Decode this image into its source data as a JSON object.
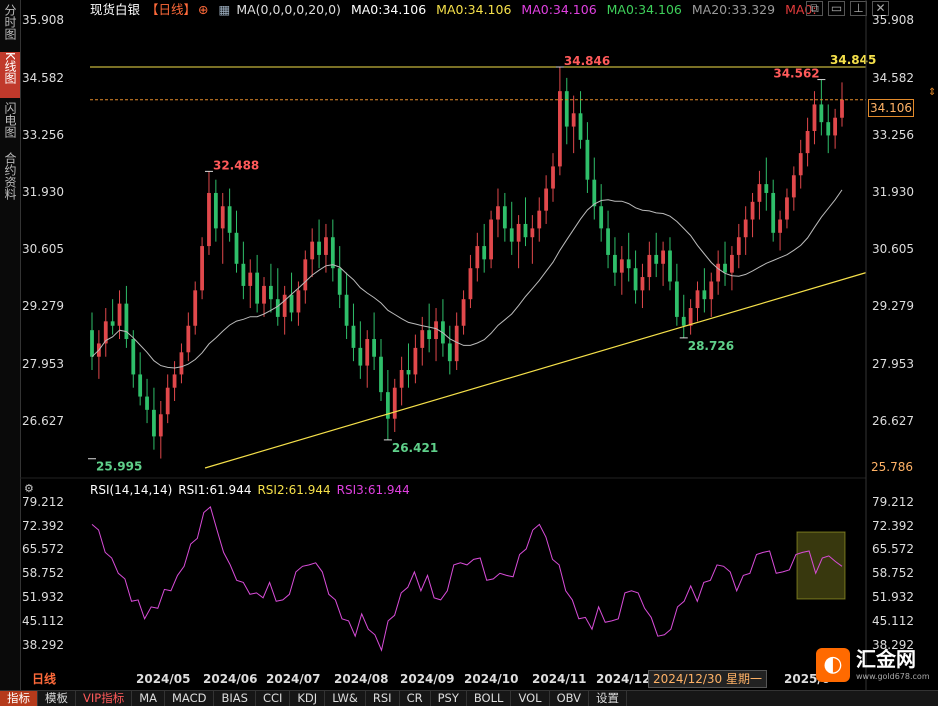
{
  "header": {
    "instrument": "现货白银",
    "period": "【日线】",
    "ma_group": "MA(0,0,0,0,20,0)",
    "ma_items": [
      {
        "label": "MA0:34.106",
        "color": "#ffffff"
      },
      {
        "label": "MA0:34.106",
        "color": "#f5e04a"
      },
      {
        "label": "MA0:34.106",
        "color": "#e040e0"
      },
      {
        "label": "MA0:34.106",
        "color": "#3ecf5a"
      },
      {
        "label": "MA20:33.329",
        "color": "#9a9a9a"
      },
      {
        "label": "MA0:",
        "color": "#e23b3b"
      }
    ]
  },
  "side_tabs": [
    {
      "label": "分时图",
      "active": false
    },
    {
      "label": "K线图",
      "active": true
    },
    {
      "label": "闪电图",
      "active": false
    },
    {
      "label": "合约资料",
      "active": false
    }
  ],
  "top_icons": [
    "layers-icon",
    "window-icon",
    "pin-icon",
    "close-icon"
  ],
  "price_axis": {
    "ticks": [
      "35.908",
      "34.582",
      "33.256",
      "31.930",
      "30.605",
      "29.279",
      "27.953",
      "26.627"
    ],
    "tick_values": [
      35.908,
      34.582,
      33.256,
      31.93,
      30.605,
      29.279,
      27.953,
      26.627
    ],
    "current_price": "34.106",
    "low_label": "25.786"
  },
  "rsi": {
    "legend": "RSI(14,14,14)",
    "rsi1": "RSI1:61.944",
    "rsi2": "RSI2:61.944",
    "rsi3": "RSI3:61.944",
    "ticks": [
      "79.212",
      "72.392",
      "65.572",
      "58.752",
      "51.932",
      "45.112",
      "38.292"
    ],
    "tick_values": [
      79.212,
      72.392,
      65.572,
      58.752,
      51.932,
      45.112,
      38.292
    ]
  },
  "date_axis": {
    "labels": [
      "2024/05",
      "2024/06",
      "2024/07",
      "2024/08",
      "2024/09",
      "2024/10",
      "2024/11",
      "2024/12",
      "2025/0"
    ],
    "cursor_date": "2024/12/30 星期一"
  },
  "bottom_toolbar": {
    "period_label": "日线",
    "items": [
      "指标",
      "模板",
      "VIP指标",
      "MA",
      "MACD",
      "BIAS",
      "CCI",
      "KDJ",
      "LW&",
      "RSI",
      "CR",
      "PSY",
      "BOLL",
      "VOL",
      "OBV",
      "设置"
    ]
  },
  "annotations": [
    {
      "text": "32.488",
      "color": "#ff5a5a"
    },
    {
      "text": "25.995",
      "color": "#5fd08a"
    },
    {
      "text": "26.421",
      "color": "#5fd08a"
    },
    {
      "text": "34.846",
      "color": "#ff5a5a"
    },
    {
      "text": "28.726",
      "color": "#5fd08a"
    },
    {
      "text": "34.562",
      "color": "#ff5a5a"
    },
    {
      "text": "34.845",
      "color": "#f5e04a"
    }
  ],
  "logo": {
    "name": "汇金网",
    "url": "www.gold678.com"
  },
  "chart_data": {
    "type": "candlestick",
    "title": "现货白银 日线",
    "ylim": [
      25.786,
      35.908
    ],
    "ma20_last": 33.329,
    "close_last": 34.106,
    "key_points": [
      {
        "label": "32.488",
        "value": 32.488,
        "kind": "high",
        "date": "2024/05"
      },
      {
        "label": "25.995",
        "value": 25.995,
        "kind": "low",
        "date": "2024/04"
      },
      {
        "label": "26.421",
        "value": 26.421,
        "kind": "low",
        "date": "2024/08"
      },
      {
        "label": "34.846",
        "value": 34.846,
        "kind": "high",
        "date": "2024/10"
      },
      {
        "label": "28.726",
        "value": 28.726,
        "kind": "low",
        "date": "2024/12"
      },
      {
        "label": "34.562",
        "value": 34.562,
        "kind": "high",
        "date": "2025/0"
      }
    ],
    "horizontal_lines": [
      {
        "value": 34.845,
        "style": "solid",
        "color": "#f5e04a"
      },
      {
        "value": 34.106,
        "style": "dashed",
        "color": "#e38a2a"
      }
    ],
    "trendline": {
      "from_value": 25.786,
      "to_value": 30.2,
      "color": "#f5e04a"
    },
    "candles": [
      {
        "o": 28.9,
        "h": 29.3,
        "l": 28.0,
        "c": 28.3
      },
      {
        "o": 28.3,
        "h": 28.9,
        "l": 27.8,
        "c": 28.6
      },
      {
        "o": 28.6,
        "h": 29.4,
        "l": 28.3,
        "c": 29.1
      },
      {
        "o": 29.1,
        "h": 29.6,
        "l": 28.8,
        "c": 29.0
      },
      {
        "o": 29.0,
        "h": 29.8,
        "l": 28.7,
        "c": 29.5
      },
      {
        "o": 29.5,
        "h": 29.9,
        "l": 28.5,
        "c": 28.7
      },
      {
        "o": 28.7,
        "h": 28.9,
        "l": 27.6,
        "c": 27.9
      },
      {
        "o": 27.9,
        "h": 28.4,
        "l": 27.2,
        "c": 27.4
      },
      {
        "o": 27.4,
        "h": 27.8,
        "l": 26.8,
        "c": 27.1
      },
      {
        "o": 27.1,
        "h": 27.6,
        "l": 26.2,
        "c": 26.5
      },
      {
        "o": 26.5,
        "h": 27.3,
        "l": 26.0,
        "c": 27.0
      },
      {
        "o": 27.0,
        "h": 27.9,
        "l": 26.8,
        "c": 27.6
      },
      {
        "o": 27.6,
        "h": 28.2,
        "l": 27.3,
        "c": 27.9
      },
      {
        "o": 27.9,
        "h": 28.6,
        "l": 27.7,
        "c": 28.4
      },
      {
        "o": 28.4,
        "h": 29.3,
        "l": 28.2,
        "c": 29.0
      },
      {
        "o": 29.0,
        "h": 30.0,
        "l": 28.8,
        "c": 29.8
      },
      {
        "o": 29.8,
        "h": 31.0,
        "l": 29.6,
        "c": 30.8
      },
      {
        "o": 30.8,
        "h": 32.488,
        "l": 30.6,
        "c": 32.0
      },
      {
        "o": 32.0,
        "h": 32.3,
        "l": 30.9,
        "c": 31.2
      },
      {
        "o": 31.2,
        "h": 32.0,
        "l": 30.4,
        "c": 31.7
      },
      {
        "o": 31.7,
        "h": 32.1,
        "l": 30.9,
        "c": 31.1
      },
      {
        "o": 31.1,
        "h": 31.6,
        "l": 30.2,
        "c": 30.4
      },
      {
        "o": 30.4,
        "h": 30.9,
        "l": 29.6,
        "c": 29.9
      },
      {
        "o": 29.9,
        "h": 30.5,
        "l": 29.4,
        "c": 30.2
      },
      {
        "o": 30.2,
        "h": 30.6,
        "l": 29.3,
        "c": 29.5
      },
      {
        "o": 29.5,
        "h": 30.1,
        "l": 29.2,
        "c": 29.9
      },
      {
        "o": 29.9,
        "h": 30.4,
        "l": 29.3,
        "c": 29.6
      },
      {
        "o": 29.6,
        "h": 30.3,
        "l": 29.0,
        "c": 29.2
      },
      {
        "o": 29.2,
        "h": 29.9,
        "l": 28.8,
        "c": 29.7
      },
      {
        "o": 29.7,
        "h": 30.2,
        "l": 29.1,
        "c": 29.3
      },
      {
        "o": 29.3,
        "h": 30.0,
        "l": 29.0,
        "c": 29.8
      },
      {
        "o": 29.8,
        "h": 30.7,
        "l": 29.5,
        "c": 30.5
      },
      {
        "o": 30.5,
        "h": 31.2,
        "l": 30.1,
        "c": 30.9
      },
      {
        "o": 30.9,
        "h": 31.4,
        "l": 30.3,
        "c": 30.6
      },
      {
        "o": 30.6,
        "h": 31.3,
        "l": 30.2,
        "c": 31.0
      },
      {
        "o": 31.0,
        "h": 31.4,
        "l": 30.0,
        "c": 30.3
      },
      {
        "o": 30.3,
        "h": 30.8,
        "l": 29.4,
        "c": 29.7
      },
      {
        "o": 29.7,
        "h": 30.2,
        "l": 28.7,
        "c": 29.0
      },
      {
        "o": 29.0,
        "h": 29.5,
        "l": 28.2,
        "c": 28.5
      },
      {
        "o": 28.5,
        "h": 29.1,
        "l": 27.8,
        "c": 28.1
      },
      {
        "o": 28.1,
        "h": 28.9,
        "l": 27.6,
        "c": 28.7
      },
      {
        "o": 28.7,
        "h": 29.3,
        "l": 28.0,
        "c": 28.3
      },
      {
        "o": 28.3,
        "h": 28.7,
        "l": 27.3,
        "c": 27.5
      },
      {
        "o": 27.5,
        "h": 28.0,
        "l": 26.421,
        "c": 26.9
      },
      {
        "o": 26.9,
        "h": 27.8,
        "l": 26.6,
        "c": 27.6
      },
      {
        "o": 27.6,
        "h": 28.3,
        "l": 27.2,
        "c": 28.0
      },
      {
        "o": 28.0,
        "h": 28.6,
        "l": 27.6,
        "c": 27.9
      },
      {
        "o": 27.9,
        "h": 28.8,
        "l": 27.7,
        "c": 28.5
      },
      {
        "o": 28.5,
        "h": 29.2,
        "l": 28.1,
        "c": 28.9
      },
      {
        "o": 28.9,
        "h": 29.5,
        "l": 28.4,
        "c": 28.7
      },
      {
        "o": 28.7,
        "h": 29.4,
        "l": 28.2,
        "c": 29.1
      },
      {
        "o": 29.1,
        "h": 29.6,
        "l": 28.3,
        "c": 28.6
      },
      {
        "o": 28.6,
        "h": 29.0,
        "l": 27.9,
        "c": 28.2
      },
      {
        "o": 28.2,
        "h": 29.3,
        "l": 28.0,
        "c": 29.0
      },
      {
        "o": 29.0,
        "h": 29.8,
        "l": 28.8,
        "c": 29.6
      },
      {
        "o": 29.6,
        "h": 30.6,
        "l": 29.4,
        "c": 30.3
      },
      {
        "o": 30.3,
        "h": 31.1,
        "l": 30.0,
        "c": 30.8
      },
      {
        "o": 30.8,
        "h": 31.3,
        "l": 30.2,
        "c": 30.5
      },
      {
        "o": 30.5,
        "h": 31.6,
        "l": 30.3,
        "c": 31.4
      },
      {
        "o": 31.4,
        "h": 32.1,
        "l": 31.0,
        "c": 31.7
      },
      {
        "o": 31.7,
        "h": 32.0,
        "l": 30.9,
        "c": 31.2
      },
      {
        "o": 31.2,
        "h": 31.8,
        "l": 30.6,
        "c": 30.9
      },
      {
        "o": 30.9,
        "h": 31.5,
        "l": 30.3,
        "c": 31.3
      },
      {
        "o": 31.3,
        "h": 31.9,
        "l": 30.8,
        "c": 31.0
      },
      {
        "o": 31.0,
        "h": 31.5,
        "l": 30.4,
        "c": 31.2
      },
      {
        "o": 31.2,
        "h": 31.9,
        "l": 30.9,
        "c": 31.6
      },
      {
        "o": 31.6,
        "h": 32.4,
        "l": 31.3,
        "c": 32.1
      },
      {
        "o": 32.1,
        "h": 32.9,
        "l": 31.8,
        "c": 32.6
      },
      {
        "o": 32.6,
        "h": 34.846,
        "l": 32.4,
        "c": 34.3
      },
      {
        "o": 34.3,
        "h": 34.6,
        "l": 33.1,
        "c": 33.5
      },
      {
        "o": 33.5,
        "h": 34.2,
        "l": 32.9,
        "c": 33.8
      },
      {
        "o": 33.8,
        "h": 34.3,
        "l": 33.0,
        "c": 33.2
      },
      {
        "o": 33.2,
        "h": 33.6,
        "l": 32.0,
        "c": 32.3
      },
      {
        "o": 32.3,
        "h": 32.8,
        "l": 31.4,
        "c": 31.7
      },
      {
        "o": 31.7,
        "h": 32.2,
        "l": 30.9,
        "c": 31.2
      },
      {
        "o": 31.2,
        "h": 31.6,
        "l": 30.3,
        "c": 30.6
      },
      {
        "o": 30.6,
        "h": 31.0,
        "l": 29.9,
        "c": 30.2
      },
      {
        "o": 30.2,
        "h": 30.8,
        "l": 29.7,
        "c": 30.5
      },
      {
        "o": 30.5,
        "h": 31.1,
        "l": 30.0,
        "c": 30.3
      },
      {
        "o": 30.3,
        "h": 30.7,
        "l": 29.5,
        "c": 29.8
      },
      {
        "o": 29.8,
        "h": 30.4,
        "l": 29.4,
        "c": 30.1
      },
      {
        "o": 30.1,
        "h": 30.9,
        "l": 29.8,
        "c": 30.6
      },
      {
        "o": 30.6,
        "h": 31.1,
        "l": 30.1,
        "c": 30.4
      },
      {
        "o": 30.4,
        "h": 30.9,
        "l": 29.9,
        "c": 30.7
      },
      {
        "o": 30.7,
        "h": 31.0,
        "l": 29.8,
        "c": 30.0
      },
      {
        "o": 30.0,
        "h": 30.4,
        "l": 29.0,
        "c": 29.2
      },
      {
        "o": 29.2,
        "h": 29.7,
        "l": 28.726,
        "c": 29.0
      },
      {
        "o": 29.0,
        "h": 29.6,
        "l": 28.8,
        "c": 29.4
      },
      {
        "o": 29.4,
        "h": 30.0,
        "l": 29.1,
        "c": 29.8
      },
      {
        "o": 29.8,
        "h": 30.3,
        "l": 29.3,
        "c": 29.6
      },
      {
        "o": 29.6,
        "h": 30.2,
        "l": 29.2,
        "c": 30.0
      },
      {
        "o": 30.0,
        "h": 30.7,
        "l": 29.7,
        "c": 30.4
      },
      {
        "o": 30.4,
        "h": 30.9,
        "l": 29.9,
        "c": 30.2
      },
      {
        "o": 30.2,
        "h": 30.8,
        "l": 29.8,
        "c": 30.6
      },
      {
        "o": 30.6,
        "h": 31.3,
        "l": 30.3,
        "c": 31.0
      },
      {
        "o": 31.0,
        "h": 31.7,
        "l": 30.6,
        "c": 31.4
      },
      {
        "o": 31.4,
        "h": 32.0,
        "l": 31.0,
        "c": 31.8
      },
      {
        "o": 31.8,
        "h": 32.5,
        "l": 31.4,
        "c": 32.2
      },
      {
        "o": 32.2,
        "h": 32.8,
        "l": 31.6,
        "c": 32.0
      },
      {
        "o": 32.0,
        "h": 32.3,
        "l": 30.9,
        "c": 31.1
      },
      {
        "o": 31.1,
        "h": 31.6,
        "l": 30.7,
        "c": 31.4
      },
      {
        "o": 31.4,
        "h": 32.1,
        "l": 31.2,
        "c": 31.9
      },
      {
        "o": 31.9,
        "h": 32.6,
        "l": 31.6,
        "c": 32.4
      },
      {
        "o": 32.4,
        "h": 33.2,
        "l": 32.1,
        "c": 32.9
      },
      {
        "o": 32.9,
        "h": 33.7,
        "l": 32.6,
        "c": 33.4
      },
      {
        "o": 33.4,
        "h": 34.3,
        "l": 33.1,
        "c": 34.0
      },
      {
        "o": 34.0,
        "h": 34.562,
        "l": 33.3,
        "c": 33.6
      },
      {
        "o": 33.6,
        "h": 34.0,
        "l": 32.9,
        "c": 33.3
      },
      {
        "o": 33.3,
        "h": 33.9,
        "l": 33.0,
        "c": 33.7
      },
      {
        "o": 33.7,
        "h": 34.5,
        "l": 33.5,
        "c": 34.106
      }
    ],
    "rsi_series": [
      74,
      70,
      66,
      62,
      60,
      56,
      52,
      50,
      47,
      48,
      50,
      53,
      55,
      57,
      62,
      66,
      70,
      75,
      79,
      70,
      66,
      60,
      58,
      55,
      54,
      52,
      53,
      55,
      52,
      50,
      54,
      58,
      62,
      60,
      63,
      58,
      54,
      50,
      47,
      44,
      42,
      46,
      44,
      40,
      38,
      44,
      48,
      52,
      56,
      58,
      55,
      57,
      53,
      50,
      55,
      60,
      63,
      60,
      64,
      62,
      58,
      56,
      60,
      57,
      59,
      63,
      67,
      70,
      74,
      68,
      64,
      60,
      55,
      50,
      47,
      45,
      44,
      48,
      46,
      44,
      47,
      52,
      55,
      52,
      50,
      45,
      42,
      40,
      44,
      48,
      52,
      54,
      52,
      55,
      58,
      60,
      62,
      58,
      55,
      57,
      60,
      63,
      66,
      64,
      60,
      58,
      61,
      63,
      66,
      64,
      60,
      62,
      65,
      61,
      62
    ]
  }
}
